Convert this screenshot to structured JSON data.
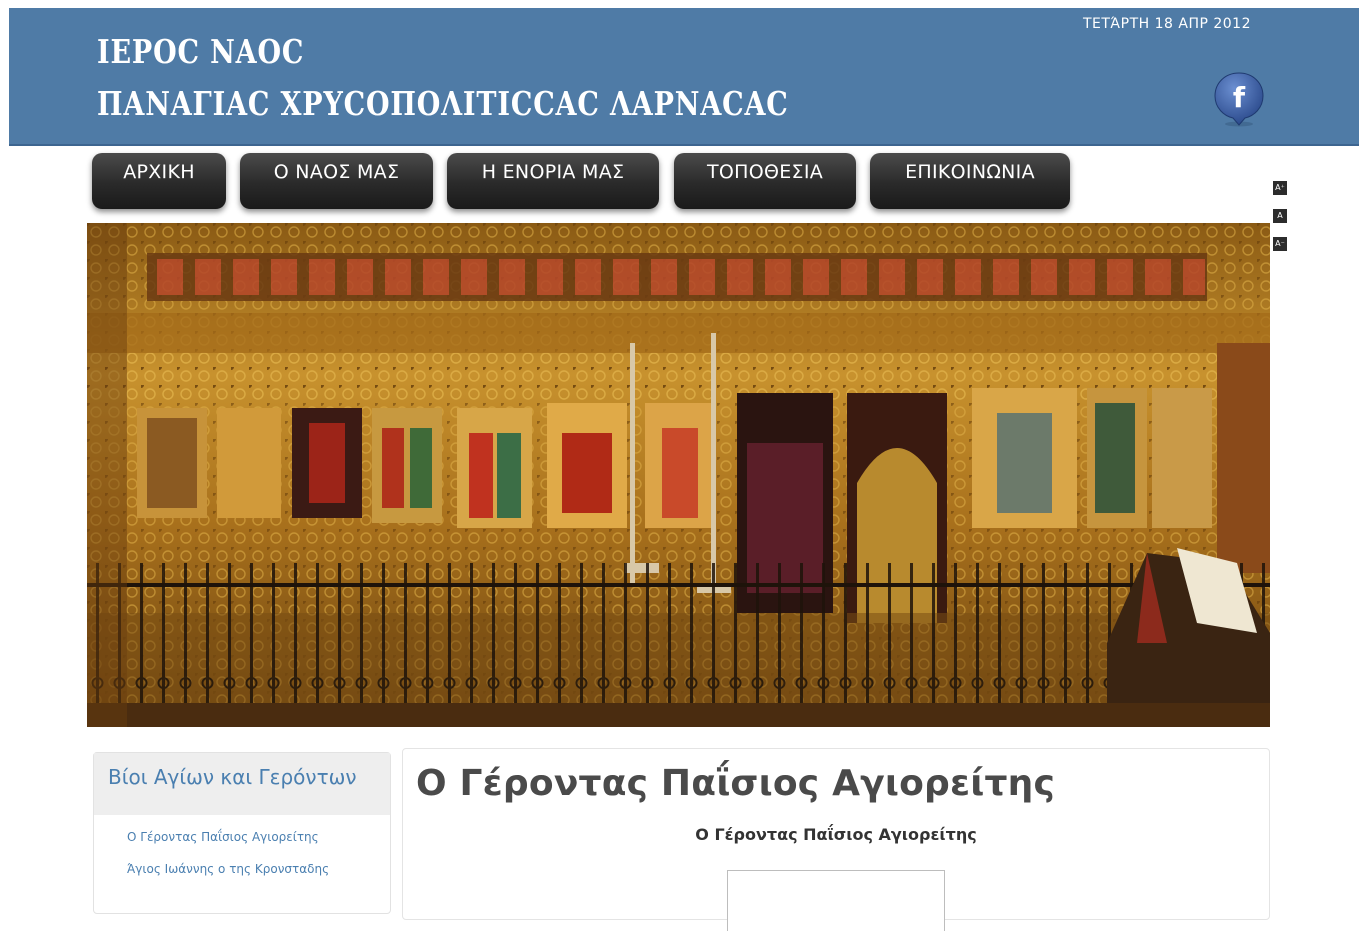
{
  "header": {
    "title_line1": "ΙΕΡΟC ΝΑΟC",
    "title_line2": "ΠΑΝΑΓΙΑC ΧΡΥCΟΠΟΛΙΤΙCCΑC ΛΑΡΝΑCΑC",
    "date": "ΤΕΤΆΡΤΗ 18 ΑΠΡ 2012",
    "social_icon": "facebook-icon"
  },
  "nav": {
    "items": [
      {
        "label": "ΑΡΧΙΚΗ"
      },
      {
        "label": "Ο ΝΑΟΣ ΜΑΣ"
      },
      {
        "label": "Η ΕΝΟΡΙΑ ΜΑΣ"
      },
      {
        "label": "ΤΟΠΟΘΕΣΙΑ"
      },
      {
        "label": "ΕΠΙΚΟΙΝΩΝΙΑ"
      }
    ]
  },
  "font_tools": {
    "increase": "A⁺",
    "reset": "A",
    "decrease": "A⁻"
  },
  "sidebar": {
    "heading": "Βίοι Αγίων και Γερόντων",
    "items": [
      {
        "label": "Ο Γέροντας Παΐσιος Αγιορείτης"
      },
      {
        "label": "Άγιος Ιωάννης ο της Κρονσταδης"
      }
    ]
  },
  "article": {
    "title": "Ο Γέροντας Παΐσιος Αγιορείτης",
    "subtitle": "Ο Γέροντας  Παΐσιος Αγιορείτης"
  },
  "colors": {
    "header_bg": "#4f7ba6",
    "nav_bg": "#2a2a2a",
    "link": "#4a7fb0"
  }
}
